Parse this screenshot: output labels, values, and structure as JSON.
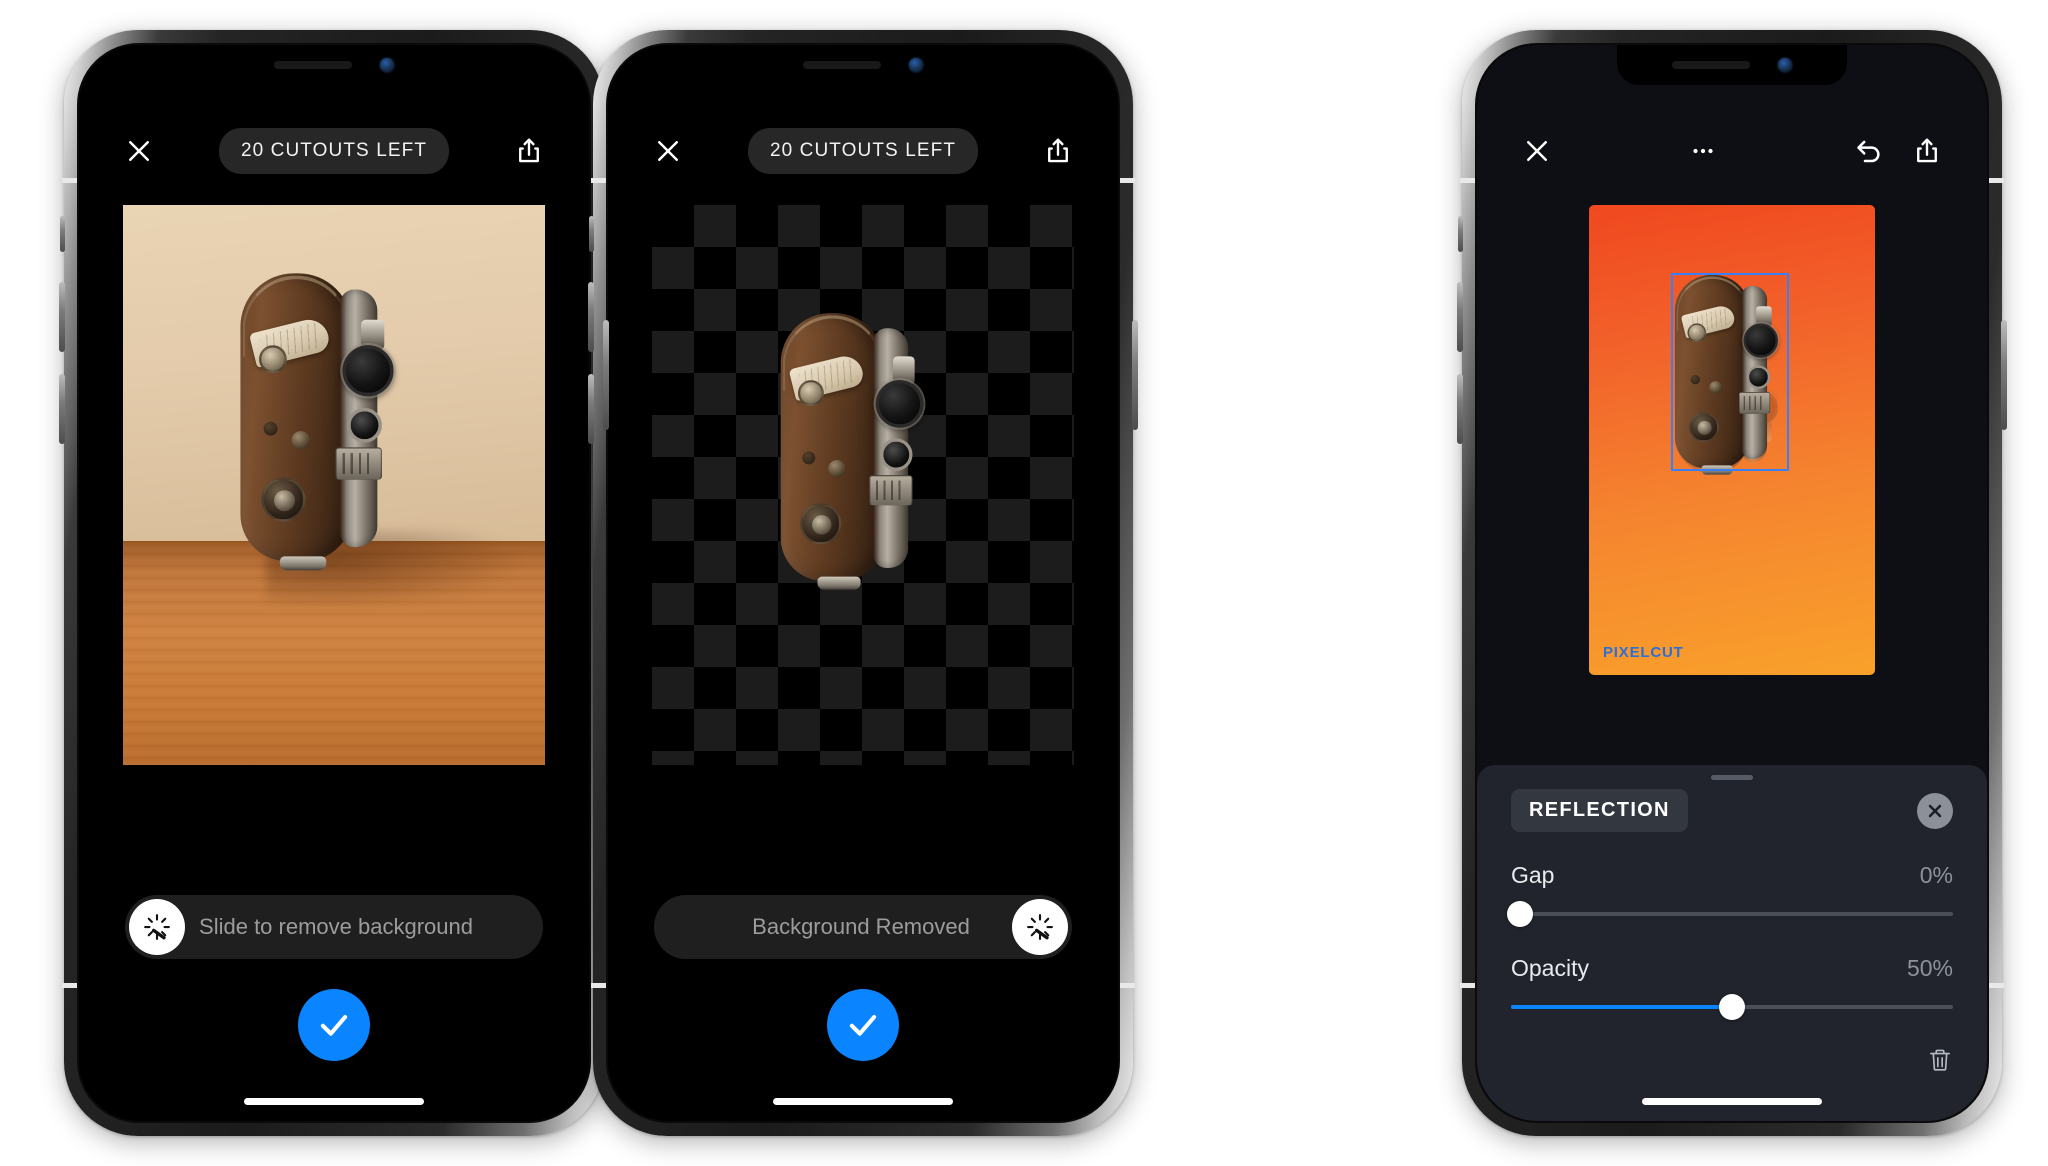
{
  "colors": {
    "accent_blue": "#0b84ff",
    "selection_blue": "#3b7ff5",
    "watermark_blue": "#2b6fd6",
    "panel_bg": "#21242c",
    "pill_bg": "#272727",
    "screen_black": "#000000",
    "checker_light": "#1c1c1c",
    "gradient_start": "#f0481f",
    "gradient_end": "#f9a12b"
  },
  "phones": [
    {
      "id": "phone-1",
      "toolbar": {
        "close_label": "Close",
        "badge": "20 CUTOUTS LEFT",
        "share_label": "Share"
      },
      "canvas": {
        "type": "photo",
        "subject": "vintage brown movie camera on wooden table"
      },
      "slider_bar": {
        "label": "Slide to remove background",
        "knob_icon": "magic-wand-icon",
        "knob_position": "left"
      },
      "confirm": {
        "icon": "checkmark-icon",
        "label": "Confirm"
      }
    },
    {
      "id": "phone-2",
      "toolbar": {
        "close_label": "Close",
        "badge": "20 CUTOUTS LEFT",
        "share_label": "Share"
      },
      "canvas": {
        "type": "transparent-checkerboard",
        "subject": "vintage brown movie camera cutout"
      },
      "slider_bar": {
        "label": "Background Removed",
        "knob_icon": "magic-wand-icon",
        "knob_position": "right"
      },
      "confirm": {
        "icon": "checkmark-icon",
        "label": "Confirm"
      }
    },
    {
      "id": "phone-3",
      "toolbar": {
        "close_label": "Close",
        "more_label": "More options",
        "undo_label": "Undo",
        "share_label": "Share"
      },
      "canvas": {
        "type": "gradient-composition",
        "watermark": "PIXELCUT",
        "selection": "camera-layer"
      },
      "panel": {
        "title": "REFLECTION",
        "close_label": "Close panel",
        "delete_label": "Delete",
        "controls": [
          {
            "name": "Gap",
            "value": "0%",
            "percent": 0
          },
          {
            "name": "Opacity",
            "value": "50%",
            "percent": 50
          }
        ]
      }
    }
  ]
}
